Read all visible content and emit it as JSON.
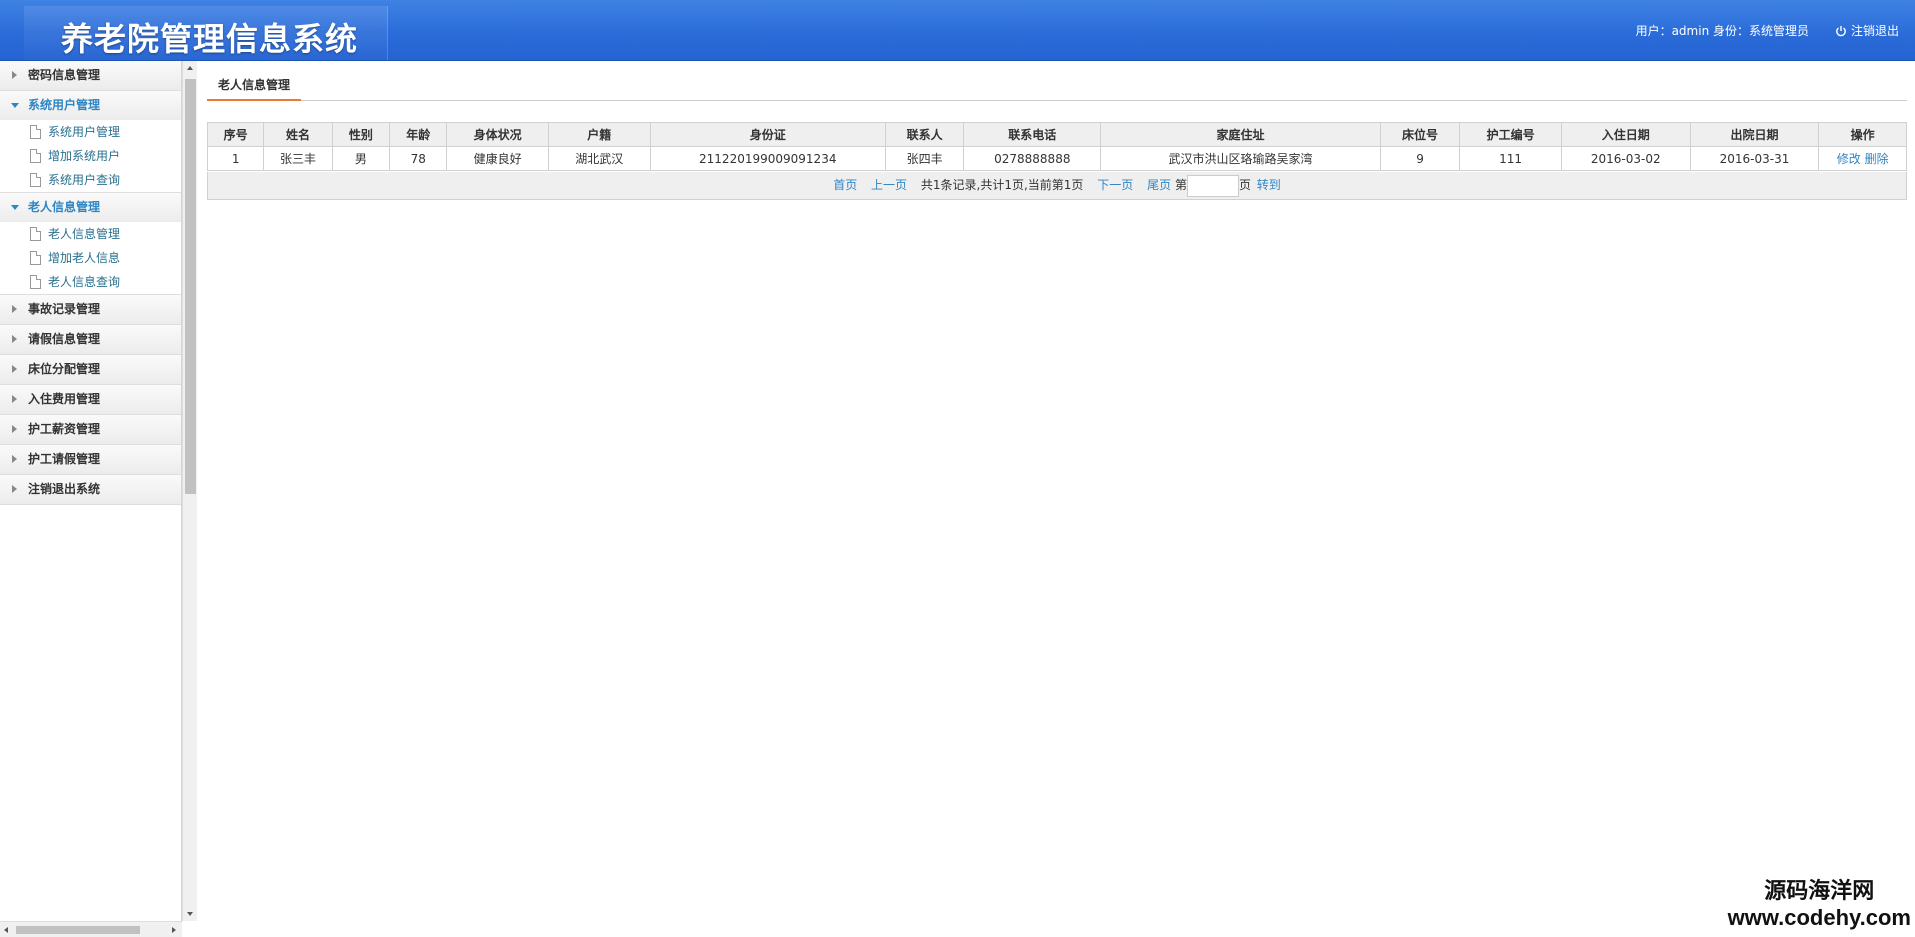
{
  "header": {
    "title": "养老院管理信息系统",
    "user_info": "用户：admin 身份：系统管理员",
    "logout": "注销退出"
  },
  "sidebar": {
    "groups": [
      {
        "label": "密码信息管理",
        "open": false,
        "items": []
      },
      {
        "label": "系统用户管理",
        "open": true,
        "items": [
          "系统用户管理",
          "增加系统用户",
          "系统用户查询"
        ]
      },
      {
        "label": "老人信息管理",
        "open": true,
        "items": [
          "老人信息管理",
          "增加老人信息",
          "老人信息查询"
        ]
      },
      {
        "label": "事故记录管理",
        "open": false,
        "items": []
      },
      {
        "label": "请假信息管理",
        "open": false,
        "items": []
      },
      {
        "label": "床位分配管理",
        "open": false,
        "items": []
      },
      {
        "label": "入住费用管理",
        "open": false,
        "items": []
      },
      {
        "label": "护工薪资管理",
        "open": false,
        "items": []
      },
      {
        "label": "护工请假管理",
        "open": false,
        "items": []
      },
      {
        "label": "注销退出系统",
        "open": false,
        "items": []
      }
    ]
  },
  "main": {
    "tab": "老人信息管理",
    "table": {
      "columns": [
        "序号",
        "姓名",
        "性别",
        "年龄",
        "身体状况",
        "户籍",
        "身份证",
        "联系人",
        "联系电话",
        "家庭住址",
        "床位号",
        "护工编号",
        "入住日期",
        "出院日期",
        "操作"
      ],
      "rows": [
        {
          "cells": [
            "1",
            "张三丰",
            "男",
            "78",
            "健康良好",
            "湖北武汉",
            "211220199009091234",
            "张四丰",
            "0278888888",
            "武汉市洪山区珞瑜路吴家湾",
            "9",
            "111",
            "2016-03-02",
            "2016-03-31"
          ],
          "edit": "修改",
          "delete": "删除"
        }
      ]
    },
    "pager": {
      "first": "首页",
      "prev": "上一页",
      "info": "共1条记录,共计1页,当前第1页",
      "next": "下一页",
      "last": "尾页",
      "page_prefix": "第",
      "page_value": "",
      "page_suffix": "页",
      "go": "转到"
    }
  },
  "watermark": {
    "line1": "源码海洋网",
    "line2": "www.codehy.com"
  }
}
